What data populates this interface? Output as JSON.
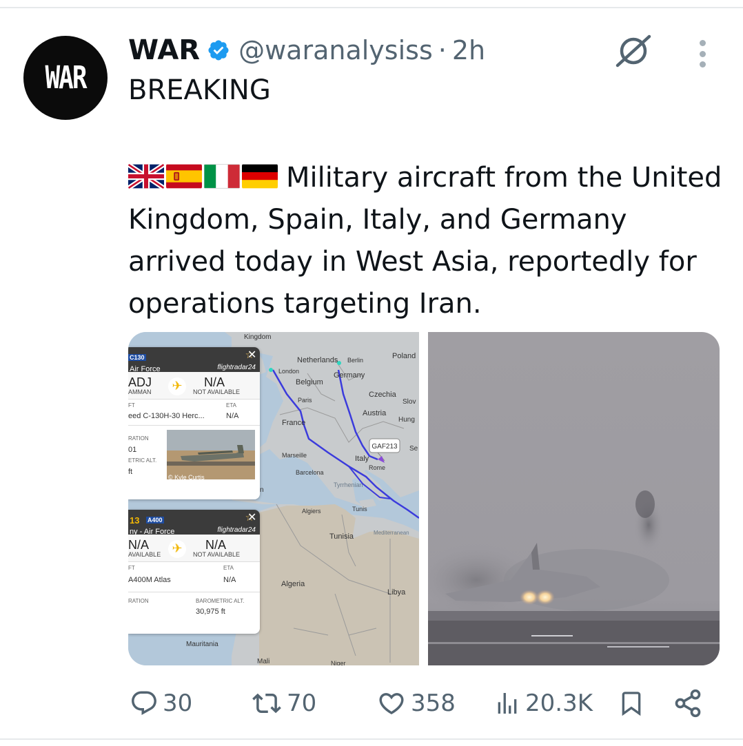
{
  "post": {
    "author": {
      "display_name": "WAR",
      "handle": "@waranalysiss",
      "verified": true,
      "avatar_text": "WAR",
      "avatar_color": "#0b0b0b"
    },
    "separator": "·",
    "time": "2h",
    "headline": "BREAKING",
    "flags": [
      "united-kingdom-flag",
      "spain-flag",
      "italy-flag",
      "germany-flag"
    ],
    "body": "Military aircraft from the United Kingdom, Spain, Italy, and Germany arrived today in West Asia, reportedly for operations targeting Iran."
  },
  "media": {
    "map": {
      "labels": {
        "kingdom": "Kingdom",
        "netherlands": "Netherlands",
        "berlin": "Berlin",
        "poland": "Poland",
        "london": "London",
        "belgium": "Belgium",
        "germany": "Germany",
        "paris": "Paris",
        "czechia": "Czechia",
        "slov": "Slov",
        "austria": "Austria",
        "hung": "Hung",
        "france": "France",
        "se": "Se",
        "marseille": "Marseille",
        "italy": "Italy",
        "rome": "Rome",
        "barcelona": "Barcelona",
        "tyrrhenian": "Tyrrhenian",
        "algiers": "Algiers",
        "tunis": "Tunis",
        "tunisia": "Tunisia",
        "mediterranean": "Mediterranean",
        "algeria": "Algeria",
        "libya": "Libya",
        "mauritania": "Mauritania",
        "mali": "Mali",
        "niger": "Niger",
        "n": "n"
      },
      "callsign_label": "GAF213"
    },
    "flight_card_1": {
      "type_tag": "C130",
      "operator": "Air Force",
      "brand": "flightradar24",
      "origin_code": "ADJ",
      "origin_name": "AMMAN",
      "dest_code": "N/A",
      "dest_name": "NOT AVAILABLE",
      "aircraft_label": "FT",
      "aircraft_value": "eed C-130H-30 Herc...",
      "eta_label": "ETA",
      "eta_value": "N/A",
      "registration_label": "RATION",
      "registration_value": "01",
      "baro_label": "ETRIC ALT.",
      "baro_value": "ft",
      "photo_credit": "© Kyle Curtis"
    },
    "flight_card_2": {
      "callsign": "13",
      "type_tag": "A400",
      "operator": "ny - Air Force",
      "brand": "flightradar24",
      "origin_code": "N/A",
      "origin_name": "AVAILABLE",
      "dest_code": "N/A",
      "dest_name": "NOT AVAILABLE",
      "aircraft_label": "FT",
      "aircraft_value": "A400M Atlas",
      "eta_label": "ETA",
      "eta_value": "N/A",
      "registration_label": "RATION",
      "baro_label": "BAROMETRIC ALT.",
      "baro_value": "30,975 ft"
    }
  },
  "actions": {
    "replies": "30",
    "reposts": "70",
    "likes": "358",
    "views": "20.3K"
  },
  "colors": {
    "secondary_text": "#536471",
    "verified_blue": "#1d9bf0",
    "track_blue": "#3b3bdc"
  }
}
